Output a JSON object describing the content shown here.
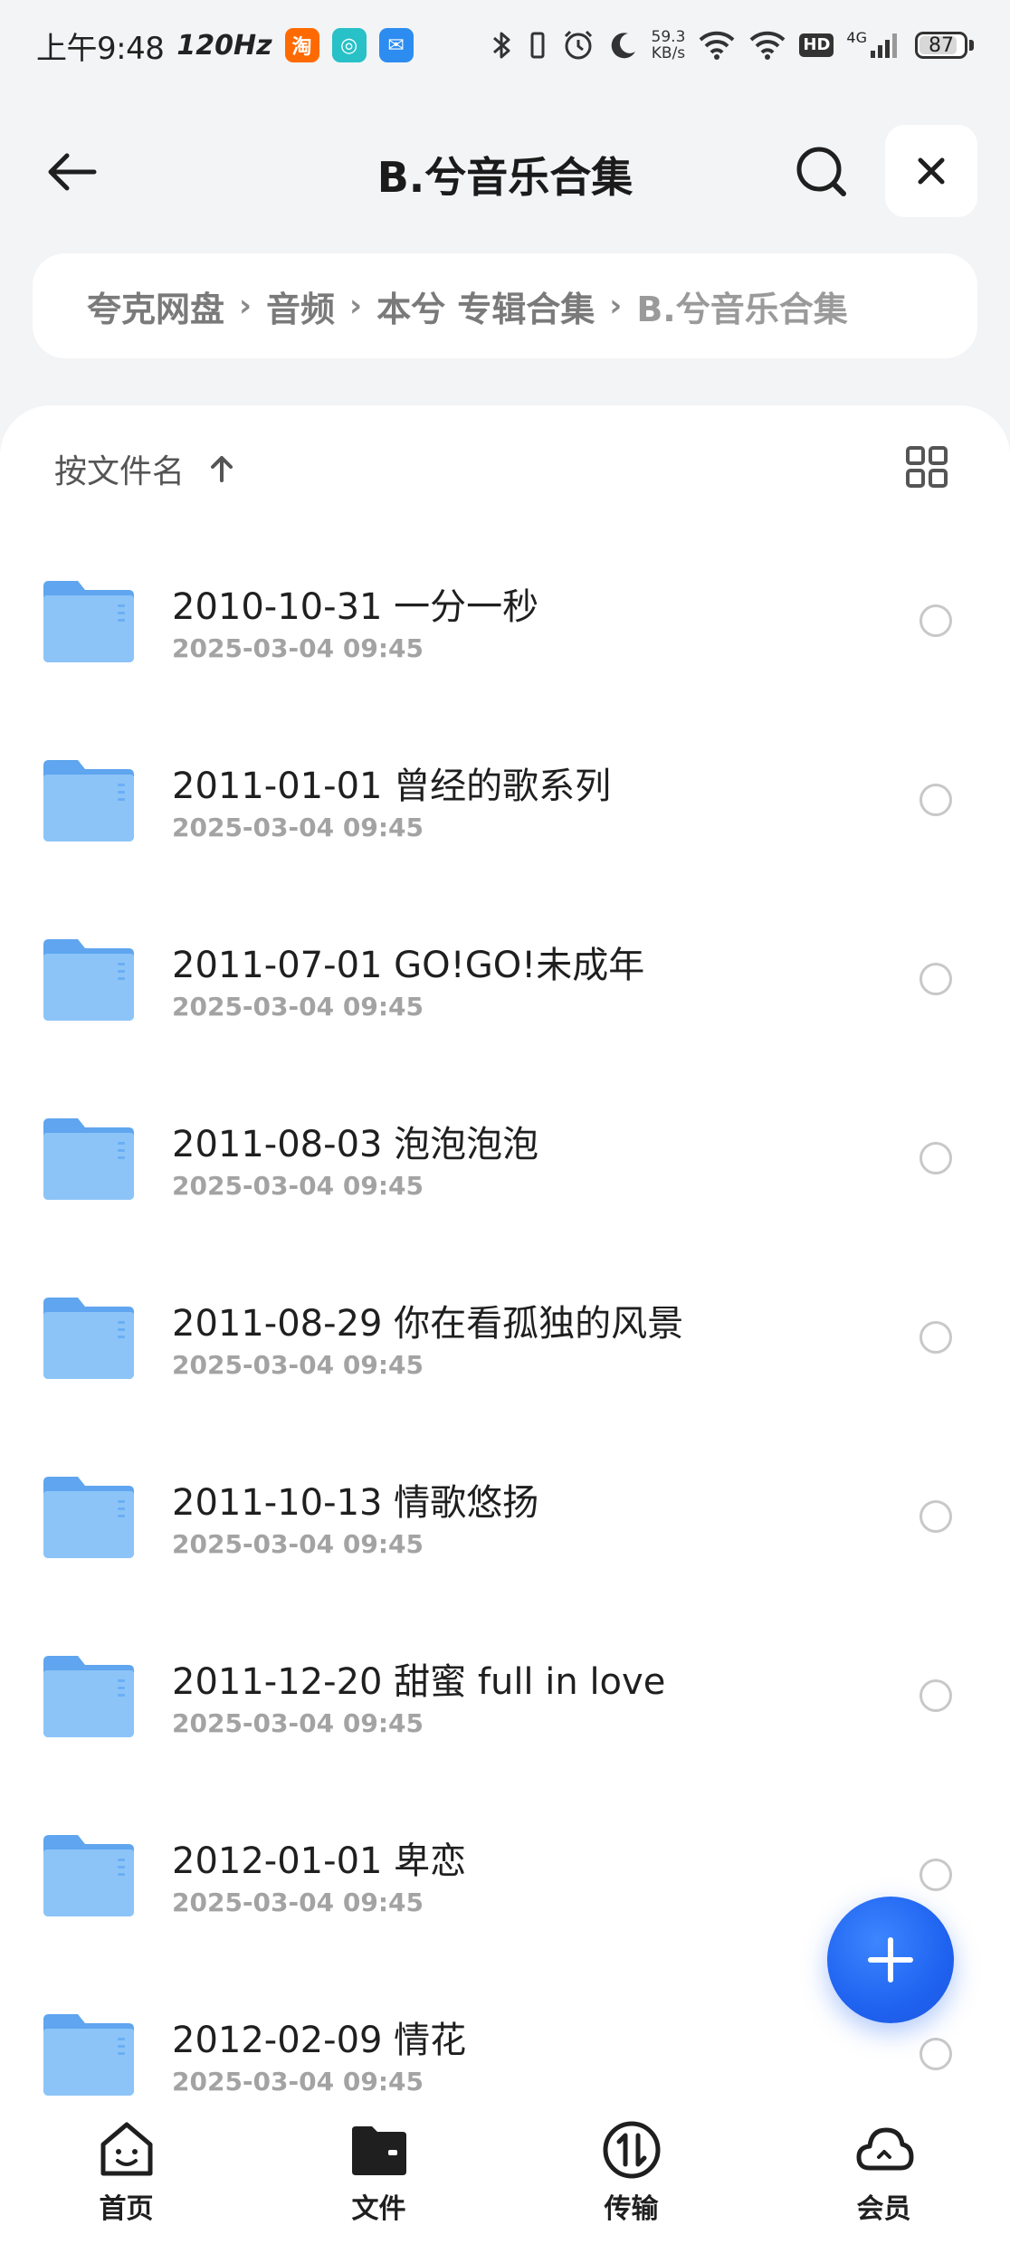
{
  "status_bar": {
    "time": "上午9:48",
    "refresh_rate": "120Hz",
    "app_badges": [
      {
        "label": "淘",
        "color": "#ff6a00"
      },
      {
        "label": "◎",
        "color": "#27c1c7"
      },
      {
        "label": "✉",
        "color": "#2d8cf0"
      }
    ],
    "net_speed_value": "59.3",
    "net_speed_unit": "KB/s",
    "hd": "HD",
    "network": "4G",
    "battery": "87",
    "battery_level": 0.87
  },
  "header": {
    "title": "B.兮音乐合集",
    "back_icon": "arrow-left-icon",
    "search_icon": "search-icon",
    "close_icon": "close-icon"
  },
  "breadcrumb": {
    "items": [
      "夸克网盘",
      "音频",
      "本兮  专辑合集",
      "B.兮音乐合集"
    ]
  },
  "sort": {
    "label": "按文件名",
    "direction_icon": "arrow-up-icon",
    "view_toggle_icon": "grid-view-icon"
  },
  "files": [
    {
      "name": "2010-10-31 一分一秒",
      "date": "2025-03-04 09:45"
    },
    {
      "name": "2011-01-01 曾经的歌系列",
      "date": "2025-03-04 09:45"
    },
    {
      "name": "2011-07-01 GO!GO!未成年",
      "date": "2025-03-04 09:45"
    },
    {
      "name": "2011-08-03 泡泡泡泡",
      "date": "2025-03-04 09:45"
    },
    {
      "name": "2011-08-29 你在看孤独的风景",
      "date": "2025-03-04 09:45"
    },
    {
      "name": "2011-10-13 情歌悠扬",
      "date": "2025-03-04 09:45"
    },
    {
      "name": "2011-12-20 甜蜜 full in love",
      "date": "2025-03-04 09:45"
    },
    {
      "name": "2012-01-01 卑恋",
      "date": "2025-03-04 09:45"
    },
    {
      "name": "2012-02-09 情花",
      "date": "2025-03-04 09:45"
    }
  ],
  "fab": {
    "icon": "plus-icon"
  },
  "bottom_nav": {
    "items": [
      {
        "label": "首页",
        "icon": "home-icon"
      },
      {
        "label": "文件",
        "icon": "folder-wallet-icon"
      },
      {
        "label": "传输",
        "icon": "transfer-icon"
      },
      {
        "label": "会员",
        "icon": "cloud-icon"
      }
    ]
  },
  "colors": {
    "accent": "#1f63f0",
    "folder": "#6aaef5",
    "background": "#f3f4f6"
  }
}
